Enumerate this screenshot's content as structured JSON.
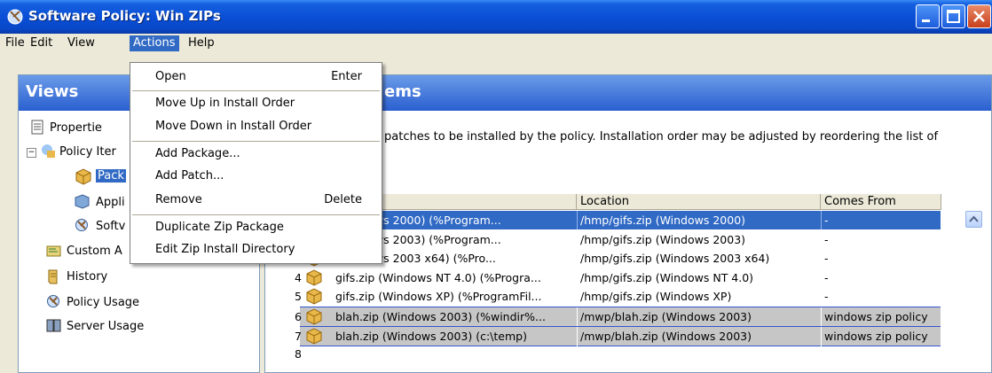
{
  "window": {
    "title": "Software Policy: Win ZIPs",
    "colors": {
      "titlebar": "#0a4fd6",
      "selection": "#316ac5",
      "group_row": "#c6c6c6"
    }
  },
  "menubar": {
    "items": [
      "File",
      "Edit",
      "View",
      "Actions",
      "Help"
    ],
    "active": "Actions"
  },
  "actions_menu": {
    "items": [
      {
        "label": "Open",
        "shortcut": "Enter"
      },
      {
        "label": "Move Up in Install Order",
        "shortcut": ""
      },
      {
        "label": "Move Down in Install Order",
        "shortcut": ""
      },
      {
        "label": "Add Package...",
        "shortcut": ""
      },
      {
        "label": "Add Patch...",
        "shortcut": ""
      },
      {
        "label": "Remove",
        "shortcut": "Delete"
      },
      {
        "label": "Duplicate Zip Package",
        "shortcut": ""
      },
      {
        "label": "Edit Zip Install Directory",
        "shortcut": ""
      }
    ]
  },
  "views": {
    "title": "Views",
    "tree": [
      {
        "label": "Propertie",
        "icon": "properties-icon"
      },
      {
        "label": "Policy Iter",
        "icon": "policy-items-icon"
      },
      {
        "label": "Pack",
        "icon": "package-icon",
        "selected": true
      },
      {
        "label": "Appli",
        "icon": "applications-icon"
      },
      {
        "label": "Softv",
        "icon": "software-icon"
      },
      {
        "label": "Custom A",
        "icon": "custom-icon"
      },
      {
        "label": "History",
        "icon": "history-icon"
      },
      {
        "label": "Policy Usage",
        "icon": "policy-usage-icon"
      },
      {
        "label": "Server Usage",
        "icon": "server-usage-icon"
      }
    ]
  },
  "items_panel": {
    "title": "ems",
    "description": "patches to be installed by the policy. Installation order may be adjusted by reordering the list of",
    "columns": [
      "Location",
      "Comes From"
    ],
    "rows": [
      {
        "num": "",
        "name": "(Windows 2000) (%Program...",
        "location": "/hmp/gifs.zip (Windows 2000)",
        "from": "-",
        "state": "selected"
      },
      {
        "num": "",
        "name": "(Windows 2003) (%Program...",
        "location": "/hmp/gifs.zip (Windows 2003)",
        "from": "-",
        "state": ""
      },
      {
        "num": "",
        "name": "(Windows 2003 x64) (%Pro...",
        "location": "/hmp/gifs.zip (Windows 2003 x64)",
        "from": "-",
        "state": ""
      },
      {
        "num": "4",
        "name": "gifs.zip (Windows NT 4.0) (%Progra...",
        "location": "/hmp/gifs.zip (Windows NT 4.0)",
        "from": "-",
        "state": ""
      },
      {
        "num": "5",
        "name": "gifs.zip (Windows XP) (%ProgramFil...",
        "location": "/hmp/gifs.zip (Windows XP)",
        "from": "-",
        "state": ""
      },
      {
        "num": "6",
        "name": "blah.zip (Windows 2003) (%windir%...",
        "location": "/mwp/blah.zip (Windows 2003)",
        "from": "windows zip policy",
        "state": "group"
      },
      {
        "num": "7",
        "name": "blah.zip (Windows 2003) (c:\\temp)",
        "location": "/mwp/blah.zip (Windows 2003)",
        "from": "windows zip policy",
        "state": "group"
      },
      {
        "num": "8",
        "name": "",
        "location": "",
        "from": "",
        "state": ""
      }
    ]
  }
}
